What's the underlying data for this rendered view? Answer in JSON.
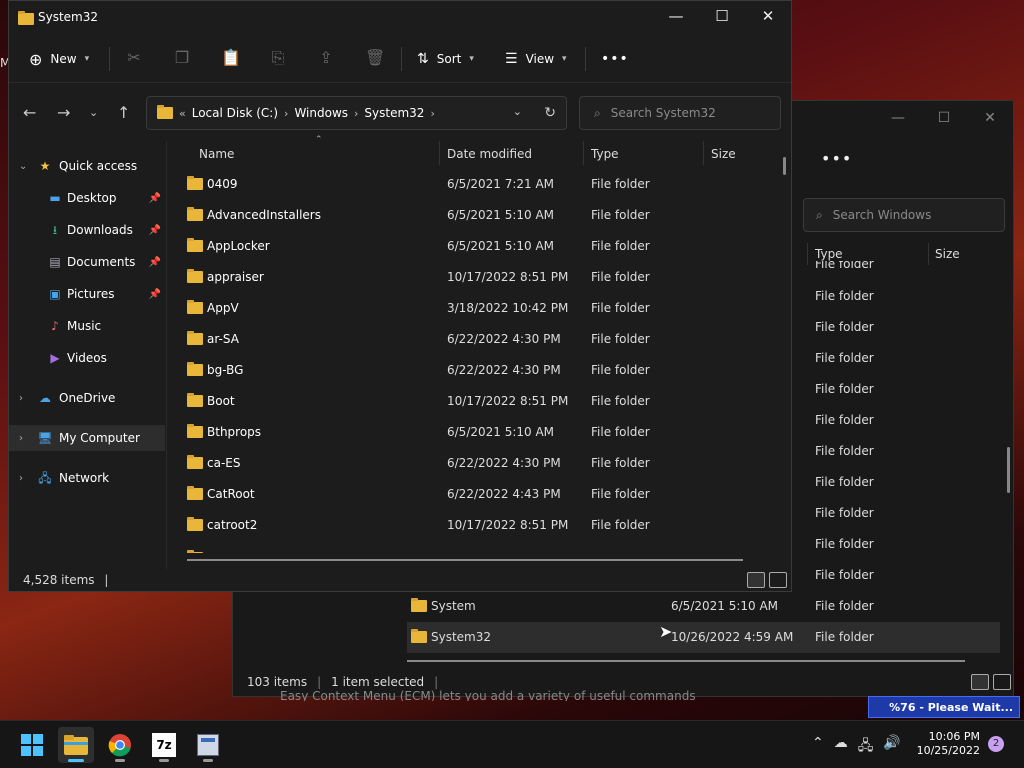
{
  "wallpaper_letter": "M",
  "back_window": {
    "more_label": "•••",
    "caption": {
      "minimize": "—",
      "maximize": "☐",
      "close": "✕"
    },
    "search_placeholder": "Search Windows",
    "columns": {
      "type": "Type",
      "size": "Size"
    },
    "partial_top_type": "File folder",
    "rows": [
      {
        "type": "File folder"
      },
      {
        "type": "File folder"
      },
      {
        "type": "File folder"
      },
      {
        "type": "File folder"
      },
      {
        "type": "File folder"
      },
      {
        "type": "File folder"
      },
      {
        "type": "File folder"
      },
      {
        "type": "File folder"
      },
      {
        "type": "File folder"
      },
      {
        "type": "File folder"
      },
      {
        "name": "System",
        "date": "6/5/2021 5:10 AM",
        "type": "File folder"
      },
      {
        "name": "System32",
        "date": "10/26/2022 4:59 AM",
        "type": "File folder"
      }
    ],
    "status": {
      "items": "103 items",
      "selected": "1 item selected"
    },
    "background_text": "Easy Context Menu (ECM) lets you add a variety of useful commands"
  },
  "front_window": {
    "title": "System32",
    "caption": {
      "minimize": "—",
      "maximize": "☐",
      "close": "✕"
    },
    "command_bar": {
      "new_label": "New",
      "sort_label": "Sort",
      "view_label": "View",
      "more_label": "•••"
    },
    "address": {
      "overflow": "«",
      "crumbs": [
        "Local Disk (C:)",
        "Windows",
        "System32"
      ]
    },
    "search_placeholder": "Search System32",
    "nav": {
      "quick_access": "Quick access",
      "items": [
        "Desktop",
        "Downloads",
        "Documents",
        "Pictures",
        "Music",
        "Videos"
      ],
      "onedrive": "OneDrive",
      "my_computer": "My Computer",
      "network": "Network"
    },
    "columns": {
      "name": "Name",
      "date": "Date modified",
      "type": "Type",
      "size": "Size"
    },
    "rows": [
      {
        "name": "0409",
        "date": "6/5/2021 7:21 AM",
        "type": "File folder"
      },
      {
        "name": "AdvancedInstallers",
        "date": "6/5/2021 5:10 AM",
        "type": "File folder"
      },
      {
        "name": "AppLocker",
        "date": "6/5/2021 5:10 AM",
        "type": "File folder"
      },
      {
        "name": "appraiser",
        "date": "10/17/2022 8:51 PM",
        "type": "File folder"
      },
      {
        "name": "AppV",
        "date": "3/18/2022 10:42 PM",
        "type": "File folder"
      },
      {
        "name": "ar-SA",
        "date": "6/22/2022 4:30 PM",
        "type": "File folder"
      },
      {
        "name": "bg-BG",
        "date": "6/22/2022 4:30 PM",
        "type": "File folder"
      },
      {
        "name": "Boot",
        "date": "10/17/2022 8:51 PM",
        "type": "File folder"
      },
      {
        "name": "Bthprops",
        "date": "6/5/2021 5:10 AM",
        "type": "File folder"
      },
      {
        "name": "ca-ES",
        "date": "6/22/2022 4:30 PM",
        "type": "File folder"
      },
      {
        "name": "CatRoot",
        "date": "6/22/2022 4:43 PM",
        "type": "File folder"
      },
      {
        "name": "catroot2",
        "date": "10/17/2022 8:51 PM",
        "type": "File folder"
      }
    ],
    "status": {
      "items": "4,528 items"
    }
  },
  "progress_popup": "%76 - Please Wait...",
  "taskbar": {
    "time": "10:06 PM",
    "date": "10/25/2022",
    "notification_count": "2",
    "apps": [
      "start-icon",
      "file-explorer-icon",
      "chrome-icon",
      "7zip-icon",
      "installer-icon"
    ]
  },
  "colors": {
    "folder": "#e8b73a",
    "accent": "#4cc2ff",
    "progress": "#1d3aa8"
  }
}
